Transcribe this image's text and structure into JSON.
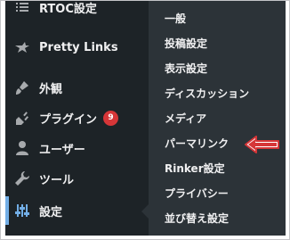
{
  "menu": {
    "items": [
      {
        "label": "RTOC設定",
        "icon": "list-icon"
      },
      {
        "label": "Pretty Links",
        "icon": "star-icon"
      },
      {
        "label": "外観",
        "icon": "paintbrush-icon"
      },
      {
        "label": "プラグイン",
        "icon": "plugin-icon",
        "badge": "9"
      },
      {
        "label": "ユーザー",
        "icon": "user-icon"
      },
      {
        "label": "ツール",
        "icon": "wrench-icon"
      },
      {
        "label": "設定",
        "icon": "settings-icon",
        "active": true
      }
    ]
  },
  "submenu": {
    "items": [
      {
        "label": "一般"
      },
      {
        "label": "投稿設定"
      },
      {
        "label": "表示設定"
      },
      {
        "label": "ディスカッション"
      },
      {
        "label": "メディア"
      },
      {
        "label": "パーマリンク",
        "highlighted": true
      },
      {
        "label": "Rinker設定"
      },
      {
        "label": "プライバシー"
      },
      {
        "label": "並び替え設定"
      }
    ]
  },
  "colors": {
    "menu_bg": "#1d2327",
    "submenu_bg": "#2c3338",
    "text": "#f0f0f1",
    "icon": "#a7aaad",
    "active_icon": "#72aee6",
    "badge_bg": "#d63638",
    "arrow": "#d63638"
  }
}
